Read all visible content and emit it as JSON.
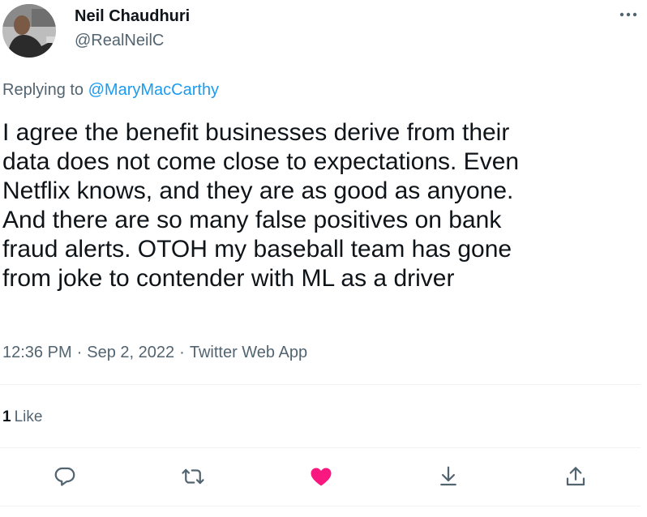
{
  "author": {
    "name": "Neil Chaudhuri",
    "handle": "@RealNeilC"
  },
  "reply": {
    "prefix": "Replying to ",
    "mention": "@MaryMacCarthy"
  },
  "tweet_text": "I agree the benefit businesses derive from their\ndata does not come close to expectations. Even\nNetflix knows, and they are as good as anyone.\nAnd there are so many false positives on bank\nfraud alerts. OTOH my baseball team has gone\nfrom joke to contender with ML as a driver",
  "meta": {
    "time": "12:36 PM",
    "separator": "·",
    "date": "Sep 2, 2022",
    "source": "Twitter Web App"
  },
  "engagement": {
    "likes_count": "1",
    "likes_label": "Like"
  },
  "colors": {
    "text": "#0f1419",
    "secondary": "#536471",
    "link": "#1d9bf0",
    "like_active": "#f91880",
    "divider": "#eff3f4"
  },
  "icons": {
    "more": "more-horizontal-icon",
    "reply": "reply-icon",
    "retweet": "retweet-icon",
    "like": "heart-filled-icon",
    "bookmark": "bookmark-down-icon",
    "share": "share-icon"
  }
}
